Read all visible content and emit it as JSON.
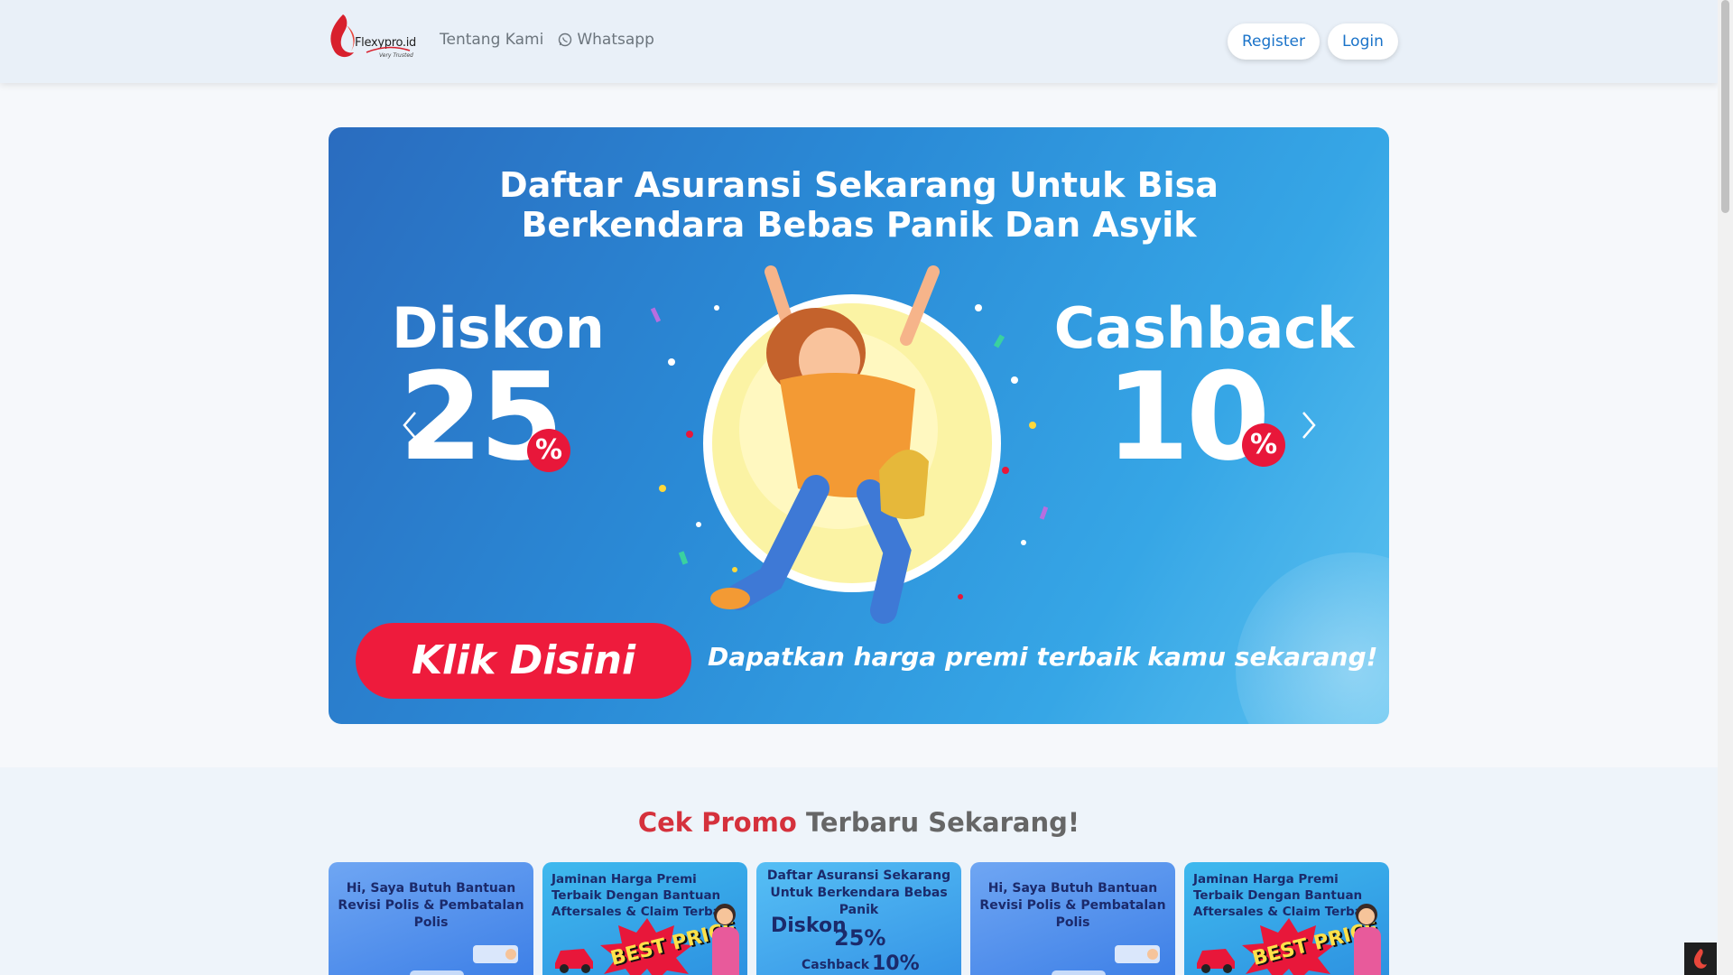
{
  "brand": {
    "name": "Flexypro.id",
    "tagline": "Very Trusted"
  },
  "nav": {
    "links": [
      "Tentang Kami",
      "Whatsapp"
    ],
    "register": "Register",
    "login": "Login"
  },
  "hero": {
    "title_line1": "Daftar Asuransi Sekarang Untuk Bisa",
    "title_line2": "Berkendara Bebas Panik Dan Asyik",
    "diskon_label": "Diskon",
    "diskon_value": "25",
    "cashback_label": "Cashback",
    "cashback_value": "10",
    "percent": "%",
    "cta": "Klik Disini",
    "tagline": "Dapatkan harga premi terbaik kamu sekarang!"
  },
  "promo": {
    "title_red": "Cek Promo",
    "title_rest": "Terbaru Sekarang!",
    "cards": [
      {
        "text": "Hi, Saya Butuh Bantuan Revisi Polis & Pembatalan Polis"
      },
      {
        "text": "Jaminan Harga Premi Terbaik Dengan Bantuan Aftersales & Claim Terbaik",
        "badge": "BEST PRICE"
      },
      {
        "text": "Daftar Asuransi Sekarang Untuk Berkendara Bebas Panik",
        "big1": "Diskon",
        "big2": "25%",
        "small": "Cashback",
        "big3": "10%"
      },
      {
        "text": "Hi, Saya Butuh Bantuan Revisi Polis & Pembatalan Polis"
      },
      {
        "text": "Jaminan Harga Premi Terbaik Dengan Bantuan Aftersales & Claim Terbaik",
        "badge": "BEST PRICE"
      }
    ]
  },
  "colors": {
    "accent_blue": "#1a73c9",
    "promo_red": "#d5313c",
    "cta_red": "#ee1b3c"
  },
  "icons": [
    "flame-logo-icon",
    "whatsapp-icon",
    "chevron-left-icon",
    "chevron-right-icon",
    "flame-fab-icon"
  ]
}
